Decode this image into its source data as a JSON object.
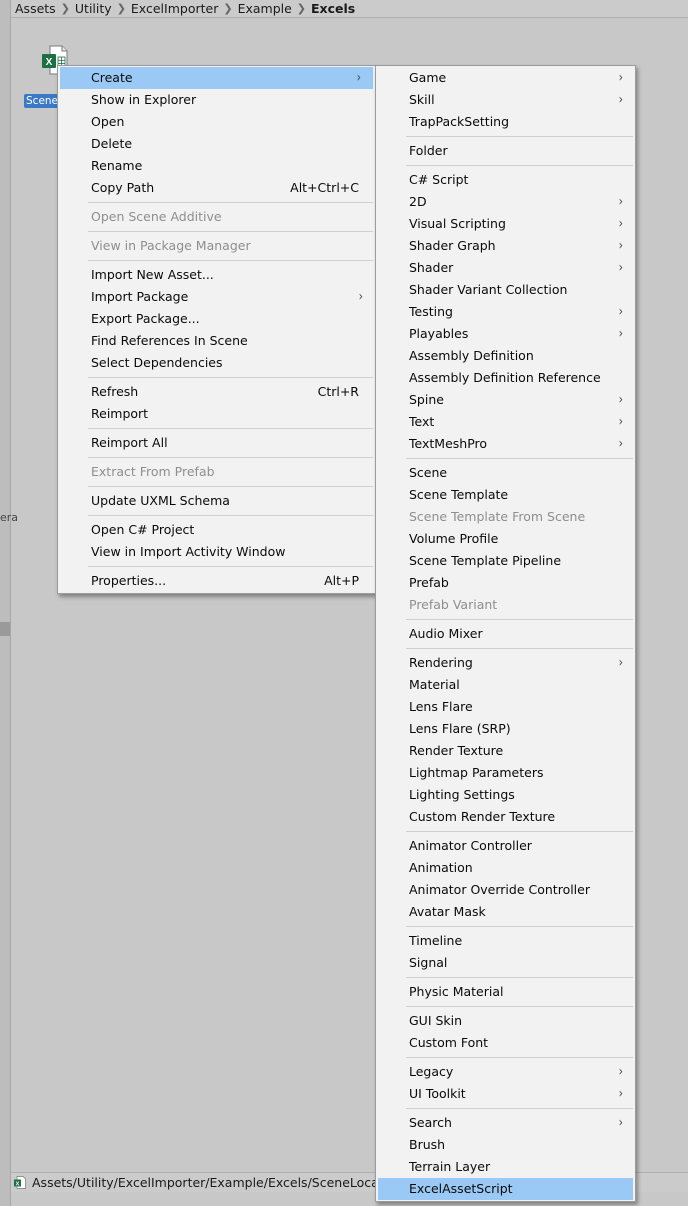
{
  "breadcrumb": [
    "Assets",
    "Utility",
    "ExcelImporter",
    "Example",
    "Excels"
  ],
  "left_fragment": "era",
  "asset": {
    "label": "Scene",
    "icon": "excel-file-icon"
  },
  "status_bar": {
    "path": "Assets/Utility/ExcelImporter/Example/Excels/SceneLocalizatio"
  },
  "colors": {
    "highlight": "#99c9f4",
    "selected_asset": "#3a79c6",
    "menu_bg": "#f2f2f2",
    "excel_green": "#1d7044"
  },
  "context_menu": {
    "groups": [
      [
        {
          "label": "Create",
          "submenu": true,
          "highlighted": true
        },
        {
          "label": "Show in Explorer"
        },
        {
          "label": "Open"
        },
        {
          "label": "Delete"
        },
        {
          "label": "Rename"
        },
        {
          "label": "Copy Path",
          "shortcut": "Alt+Ctrl+C"
        }
      ],
      [
        {
          "label": "Open Scene Additive",
          "disabled": true
        }
      ],
      [
        {
          "label": "View in Package Manager",
          "disabled": true
        }
      ],
      [
        {
          "label": "Import New Asset..."
        },
        {
          "label": "Import Package",
          "submenu": true
        },
        {
          "label": "Export Package..."
        },
        {
          "label": "Find References In Scene"
        },
        {
          "label": "Select Dependencies"
        }
      ],
      [
        {
          "label": "Refresh",
          "shortcut": "Ctrl+R"
        },
        {
          "label": "Reimport"
        }
      ],
      [
        {
          "label": "Reimport All"
        }
      ],
      [
        {
          "label": "Extract From Prefab",
          "disabled": true
        }
      ],
      [
        {
          "label": "Update UXML Schema"
        }
      ],
      [
        {
          "label": "Open C# Project"
        },
        {
          "label": "View in Import Activity Window"
        }
      ],
      [
        {
          "label": "Properties...",
          "shortcut": "Alt+P"
        }
      ]
    ]
  },
  "create_menu": {
    "groups": [
      [
        {
          "label": "Game",
          "submenu": true
        },
        {
          "label": "Skill",
          "submenu": true
        },
        {
          "label": "TrapPackSetting"
        }
      ],
      [
        {
          "label": "Folder"
        }
      ],
      [
        {
          "label": "C# Script"
        },
        {
          "label": "2D",
          "submenu": true
        },
        {
          "label": "Visual Scripting",
          "submenu": true
        },
        {
          "label": "Shader Graph",
          "submenu": true
        },
        {
          "label": "Shader",
          "submenu": true
        },
        {
          "label": "Shader Variant Collection"
        },
        {
          "label": "Testing",
          "submenu": true
        },
        {
          "label": "Playables",
          "submenu": true
        },
        {
          "label": "Assembly Definition"
        },
        {
          "label": "Assembly Definition Reference"
        },
        {
          "label": "Spine",
          "submenu": true
        },
        {
          "label": "Text",
          "submenu": true
        },
        {
          "label": "TextMeshPro",
          "submenu": true
        }
      ],
      [
        {
          "label": "Scene"
        },
        {
          "label": "Scene Template"
        },
        {
          "label": "Scene Template From Scene",
          "disabled": true
        },
        {
          "label": "Volume Profile"
        },
        {
          "label": "Scene Template Pipeline"
        },
        {
          "label": "Prefab"
        },
        {
          "label": "Prefab Variant",
          "disabled": true
        }
      ],
      [
        {
          "label": "Audio Mixer"
        }
      ],
      [
        {
          "label": "Rendering",
          "submenu": true
        },
        {
          "label": "Material"
        },
        {
          "label": "Lens Flare"
        },
        {
          "label": "Lens Flare (SRP)"
        },
        {
          "label": "Render Texture"
        },
        {
          "label": "Lightmap Parameters"
        },
        {
          "label": "Lighting Settings"
        },
        {
          "label": "Custom Render Texture"
        }
      ],
      [
        {
          "label": "Animator Controller"
        },
        {
          "label": "Animation"
        },
        {
          "label": "Animator Override Controller"
        },
        {
          "label": "Avatar Mask"
        }
      ],
      [
        {
          "label": "Timeline"
        },
        {
          "label": "Signal"
        }
      ],
      [
        {
          "label": "Physic Material"
        }
      ],
      [
        {
          "label": "GUI Skin"
        },
        {
          "label": "Custom Font"
        }
      ],
      [
        {
          "label": "Legacy",
          "submenu": true
        },
        {
          "label": "UI Toolkit",
          "submenu": true
        }
      ],
      [
        {
          "label": "Search",
          "submenu": true
        },
        {
          "label": "Brush"
        },
        {
          "label": "Terrain Layer"
        },
        {
          "label": "ExcelAssetScript",
          "highlighted": true
        }
      ]
    ]
  }
}
